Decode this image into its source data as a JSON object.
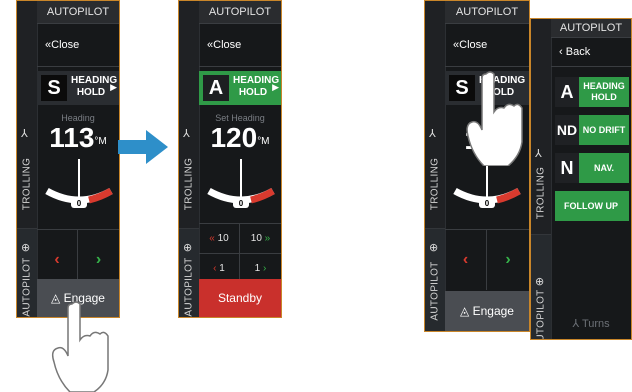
{
  "panel1": {
    "title": "AUTOPILOT",
    "close_label": "Close",
    "mode_letter": "S",
    "mode_label": "HEADING HOLD",
    "readout_caption": "Heading",
    "readout_value": "113",
    "readout_unit": "°M",
    "rudder_value": "0",
    "rail_trolling": "TROLLING",
    "rail_autopilot": "AUTOPILOT",
    "engage_label": "Engage"
  },
  "panel2": {
    "title": "AUTOPILOT",
    "close_label": "Close",
    "mode_letter": "A",
    "mode_label": "HEADING HOLD",
    "readout_caption": "Set Heading",
    "readout_value": "120",
    "readout_unit": "°M",
    "rudder_value": "0",
    "rail_trolling": "TROLLING",
    "rail_autopilot": "AUTOPILOT",
    "step_large_left": "10",
    "step_large_right": "10",
    "step_small_left": "1",
    "step_small_right": "1",
    "standby_label": "Standby"
  },
  "panel3": {
    "title": "AUTOPILOT",
    "close_label": "Close",
    "mode_letter": "S",
    "mode_label": "HEADING HOLD",
    "readout_value": "113",
    "rudder_value": "0",
    "rail_trolling": "TROLLING",
    "rail_autopilot": "AUTOPILOT",
    "engage_label": "Engage"
  },
  "panel4": {
    "title": "AUTOPILOT",
    "back_label": "Back",
    "rail_trolling": "TROLLING",
    "rail_autopilot": "AUTOPILOT",
    "items": [
      {
        "letter": "A",
        "label": "HEADING HOLD"
      },
      {
        "letter": "ND",
        "label": "NO DRIFT"
      },
      {
        "letter": "N",
        "label": "NAV."
      },
      {
        "letter": "",
        "label": "FOLLOW UP"
      }
    ],
    "turns_label": "Turns"
  },
  "colors": {
    "frame": "#c9862a",
    "green": "#2f9a47",
    "red": "#d83a2e",
    "standby": "#c9302c",
    "arrow": "#2e8fc9"
  },
  "icons": [
    "close-chevrons-icon",
    "mode-arrow-icon",
    "trolling-icon",
    "autopilot-icon",
    "engage-icon",
    "hand-pointer-icon",
    "transition-arrow-icon",
    "turns-icon"
  ]
}
